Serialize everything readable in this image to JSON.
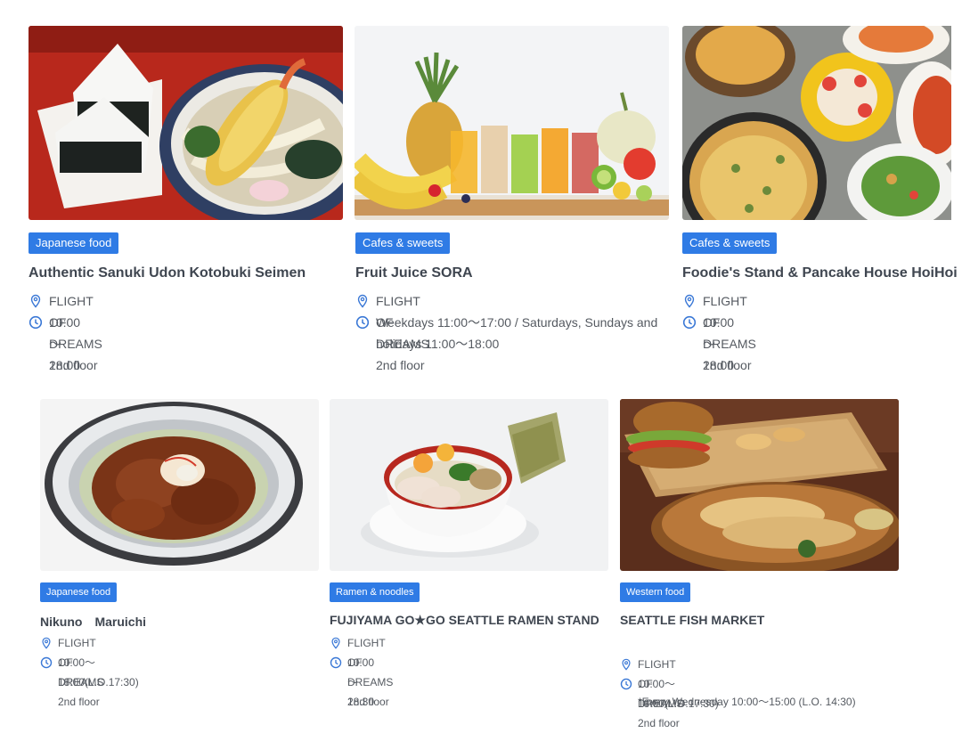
{
  "top_row": [
    {
      "category": "Japanese food",
      "name": "Authentic Sanuki Udon Kotobuki Seimen",
      "location": "FLIGHT OF DREAMS 2nd floor",
      "hours": "10:00～18:00",
      "image": "udon-onigiri-photo"
    },
    {
      "category": "Cafes & sweets",
      "name": "Fruit Juice SORA",
      "location": "FLIGHT OF DREAMS 2nd floor",
      "hours_line1": "Weekdays 11:00～17:00 / Saturdays, Sundays and",
      "hours_line2": "holidays 11:00～18:00",
      "image": "fruit-juice-photo"
    },
    {
      "category": "Cafes & sweets",
      "name": "Foodie's Stand & Pancake House HoiHoi",
      "location": "FLIGHT OF DREAMS 2nd floor",
      "hours": "10:00～18:00",
      "image": "pizza-pancake-photo"
    }
  ],
  "bottom_row": [
    {
      "category": "Japanese food",
      "name": "Nikuno　Maruichi",
      "location": "FLIGHT OF DREAMS 2nd floor",
      "hours": "10:00～18:00(L.O.17:30)",
      "image": "meat-bowl-photo"
    },
    {
      "category": "Ramen & noodles",
      "name": "FUJIYAMA GO★GO SEATTLE RAMEN STAND",
      "location": "FLIGHT OF DREAMS 2nd floor",
      "hours": "10:00～18:30",
      "image": "ramen-photo"
    },
    {
      "category": "Western food",
      "name": "SEATTLE FISH MARKET",
      "location": "FLIGHT OF DREAMS 2nd floor",
      "hours": "10:00～18:00(L.O.17:30)",
      "note": "*Every Wednesday 10:00～15:00 (L.O. 14:30)",
      "image": "fish-burger-photo"
    }
  ],
  "icons": {
    "location": "map-pin-icon",
    "hours": "clock-icon"
  },
  "colors": {
    "badge": "#2f7be5",
    "icon": "#3a78d6",
    "title": "#3f4650",
    "text": "#555a61"
  }
}
